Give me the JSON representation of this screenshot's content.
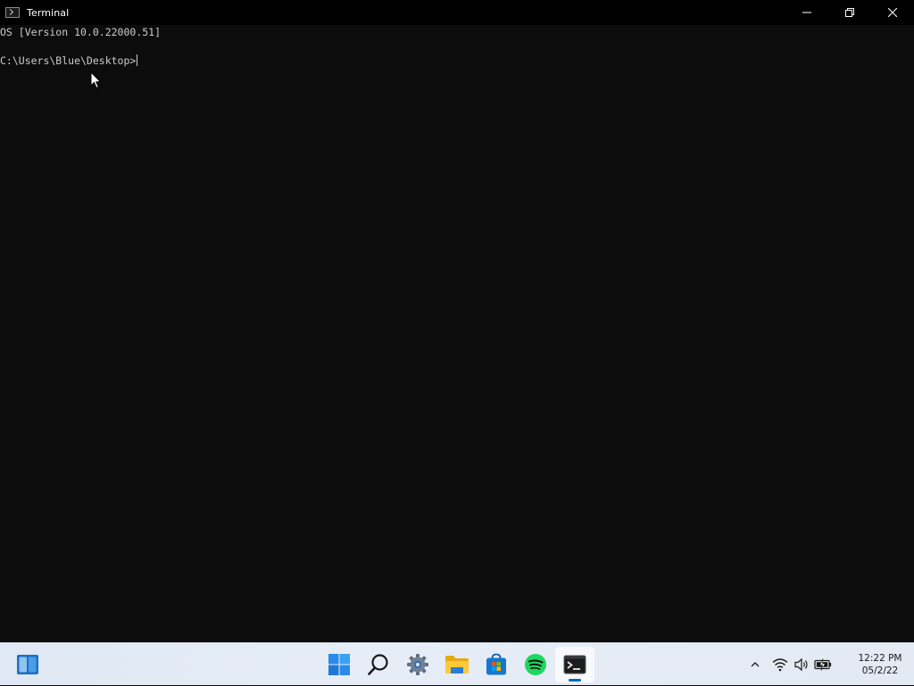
{
  "window": {
    "title": "Terminal",
    "icons": {
      "app": "terminal-icon",
      "minimize": "minimize-icon",
      "restore": "restore-icon",
      "close": "close-icon"
    }
  },
  "terminal": {
    "lines": [
      "OS [Version 10.0.22000.51]",
      "",
      "C:\\Users\\Blue\\Desktop>"
    ]
  },
  "taskbar": {
    "widgets_icon": "widgets-icon",
    "apps": [
      {
        "name": "start",
        "icon": "windows-start-icon",
        "active": false
      },
      {
        "name": "search",
        "icon": "search-icon",
        "active": false
      },
      {
        "name": "settings",
        "icon": "gear-icon",
        "active": false
      },
      {
        "name": "file-explorer",
        "icon": "folder-icon",
        "active": false
      },
      {
        "name": "microsoft-store",
        "icon": "store-icon",
        "active": false
      },
      {
        "name": "spotify",
        "icon": "spotify-icon",
        "active": false
      },
      {
        "name": "terminal",
        "icon": "terminal-icon",
        "active": true
      }
    ],
    "tray": {
      "icons": [
        "chevron-up-icon",
        "wifi-icon",
        "volume-icon",
        "battery-icon"
      ],
      "time": "12:22 PM",
      "date": "05/2/22"
    }
  },
  "colors": {
    "terminal_bg": "#0c0c0c",
    "terminal_fg": "#cccccc",
    "titlebar_bg": "#000000",
    "accent": "#0067c0"
  }
}
